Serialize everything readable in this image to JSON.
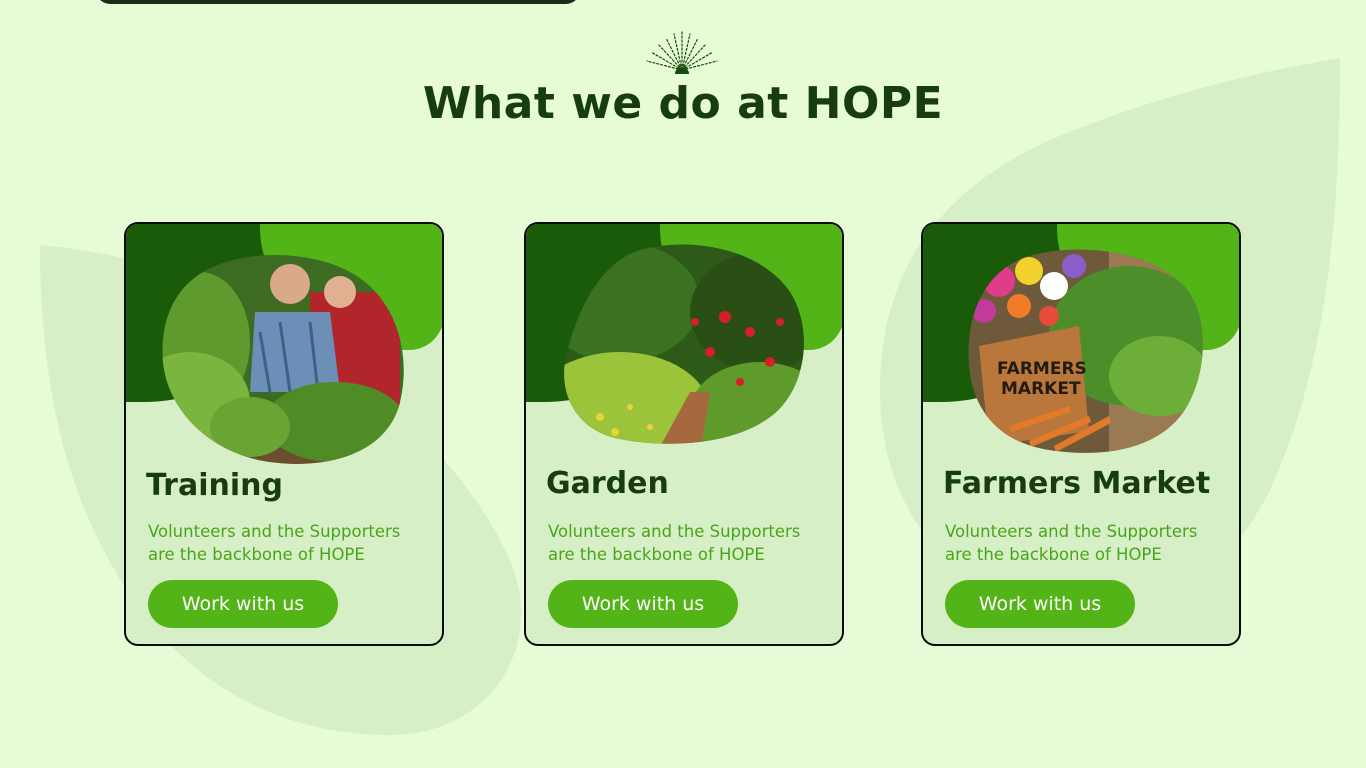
{
  "section": {
    "title": "What we do at HOPE"
  },
  "colors": {
    "background": "#e6fbd6",
    "dark_green": "#1a5b0a",
    "accent_green": "#52b417",
    "title_text": "#163c10",
    "description_text": "#48a51a"
  },
  "icons": {
    "section_ornament": "sun-rays-icon"
  },
  "cards": [
    {
      "title": "Training",
      "description": "Volunteers and the Supporters are the backbone of HOPE",
      "button_label": "Work with us",
      "photo": "gardening-training-photo"
    },
    {
      "title": "Garden",
      "description": "Volunteers and the Supporters are the backbone of HOPE",
      "button_label": "Work with us",
      "photo": "garden-path-photo"
    },
    {
      "title": "Farmers Market",
      "description": "Volunteers and the Supporters are the backbone of HOPE",
      "button_label": "Work with us",
      "photo": "farmers-market-crate-photo",
      "photo_sign_text": [
        "FARMERS",
        "MARKET"
      ]
    }
  ]
}
